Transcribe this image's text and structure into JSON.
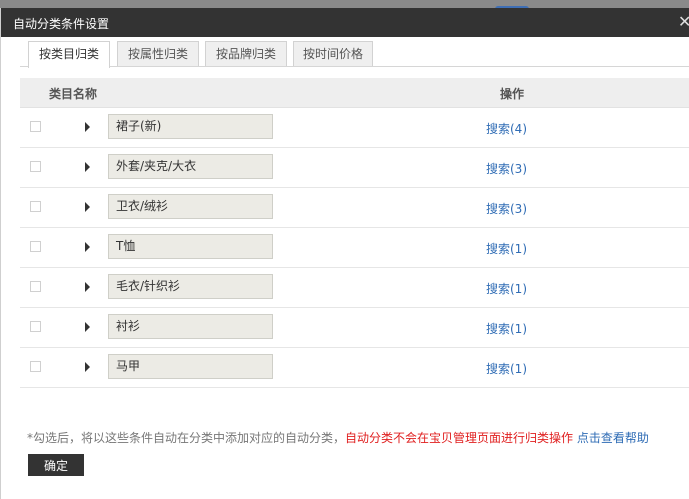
{
  "dialog": {
    "title": "自动分类条件设置",
    "close_glyph": "✕"
  },
  "tabs": [
    {
      "label": "按类目归类",
      "active": true
    },
    {
      "label": "按属性归类",
      "active": false
    },
    {
      "label": "按品牌归类",
      "active": false
    },
    {
      "label": "按时间价格",
      "active": false
    }
  ],
  "table": {
    "headers": {
      "name": "类目名称",
      "operation": "操作"
    },
    "rows": [
      {
        "name": "裙子(新)",
        "action": "搜索(4)"
      },
      {
        "name": "外套/夹克/大衣",
        "action": "搜索(3)"
      },
      {
        "name": "卫衣/绒衫",
        "action": "搜索(3)"
      },
      {
        "name": "T恤",
        "action": "搜索(1)"
      },
      {
        "name": "毛衣/针织衫",
        "action": "搜索(1)"
      },
      {
        "name": "衬衫",
        "action": "搜索(1)"
      },
      {
        "name": "马甲",
        "action": "搜索(1)"
      }
    ]
  },
  "footer": {
    "note_gray": "*勾选后，将以这些条件自动在分类中添加对应的自动分类，",
    "note_red": "自动分类不会在宝贝管理页面进行归类操作",
    "help_link": "点击查看帮助",
    "confirm_label": "确定"
  },
  "colors": {
    "titlebar": "#333333",
    "link": "#2f6cb5",
    "warning": "#e02020"
  }
}
